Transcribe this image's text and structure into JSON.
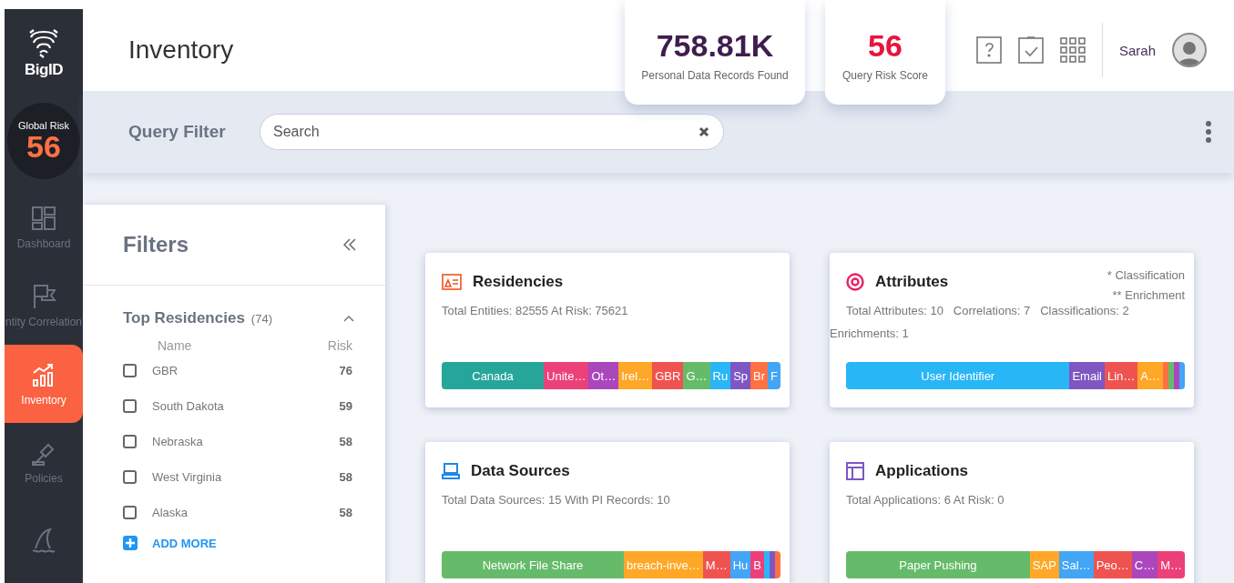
{
  "brand": "BigID",
  "global_risk": {
    "label": "Global Risk",
    "value": "56"
  },
  "nav": [
    {
      "label": "Dashboard",
      "selected": false
    },
    {
      "label": "ntity Correlation",
      "selected": false
    },
    {
      "label": "Inventory",
      "selected": true
    },
    {
      "label": "Policies",
      "selected": false
    },
    {
      "selected": false
    }
  ],
  "header": {
    "title": "Inventory",
    "user": "Sarah"
  },
  "stats": [
    {
      "value": "758.81K",
      "label": "Personal Data Records Found",
      "kind": "records"
    },
    {
      "value": "56",
      "label": "Query Risk Score",
      "kind": "risk"
    }
  ],
  "query_filter": {
    "label": "Query Filter",
    "placeholder": "Search"
  },
  "filters": {
    "title": "Filters",
    "section": {
      "title": "Top Residencies",
      "count": "(74)",
      "expanded": true,
      "columns": [
        "Name",
        "Risk"
      ],
      "rows": [
        {
          "name": "GBR",
          "risk": "76",
          "checked": false
        },
        {
          "name": "South Dakota",
          "risk": "59",
          "checked": false
        },
        {
          "name": "Nebraska",
          "risk": "58",
          "checked": false
        },
        {
          "name": "West Virginia",
          "risk": "58",
          "checked": false
        },
        {
          "name": "Alaska",
          "risk": "58",
          "checked": false
        }
      ],
      "add_more": "ADD MORE"
    }
  },
  "cards": [
    {
      "title": "Residencies",
      "lines": [
        "Total Entities: 82555 At Risk: 75621"
      ],
      "segments": [
        {
          "label": "Canada",
          "color": "#26a69a"
        },
        {
          "label": "Unite…",
          "color": "#ec407a"
        },
        {
          "label": "Ot…",
          "color": "#ab47bc"
        },
        {
          "label": "Irel…",
          "color": "#ffa726"
        },
        {
          "label": "GBR",
          "color": "#ef5350"
        },
        {
          "label": "G…",
          "color": "#66bb6a"
        },
        {
          "label": "Ru",
          "color": "#29b6f6"
        },
        {
          "label": "Sp",
          "color": "#7e57c2"
        },
        {
          "label": "Br",
          "color": "#ff7043"
        },
        {
          "label": "F",
          "color": "#42a5f5"
        }
      ]
    },
    {
      "title": "Attributes",
      "lines": [
        "Total Attributes: 10   Correlations: 7   Classifications: 2",
        "Enrichments: 1"
      ],
      "notes": [
        "* Classification",
        "** Enrichment"
      ],
      "segments": [
        {
          "label": "User Identifier",
          "color": "#29b6f6"
        },
        {
          "label": "Email",
          "color": "#7e57c2"
        },
        {
          "label": "Lin…",
          "color": "#ef5350"
        },
        {
          "label": "A…",
          "color": "#ffa726"
        },
        {
          "color": "#ff7043"
        },
        {
          "color": "#66bb6a"
        },
        {
          "color": "#ab47bc"
        },
        {
          "color": "#42a5f5"
        }
      ]
    },
    {
      "title": "Data Sources",
      "lines": [
        "Total Data Sources: 15 With PI Records: 10"
      ],
      "segments": [
        {
          "label": "Network File Share",
          "color": "#66bb6a"
        },
        {
          "label": "breach-inve…",
          "color": "#ffa726"
        },
        {
          "label": "M…",
          "color": "#ef5350"
        },
        {
          "label": "Hu",
          "color": "#42a5f5"
        },
        {
          "label": "B",
          "color": "#ec407a"
        },
        {
          "color": "#29b6f6"
        },
        {
          "color": "#7e57c2"
        },
        {
          "color": "#ff7043"
        }
      ]
    },
    {
      "title": "Applications",
      "lines": [
        "Total Applications: 6 At Risk: 0"
      ],
      "segments": [
        {
          "label": "Paper Pushing",
          "color": "#66bb6a"
        },
        {
          "label": "SAP",
          "color": "#ffa726"
        },
        {
          "label": "Sal…",
          "color": "#42a5f5"
        },
        {
          "label": "Peo…",
          "color": "#ef5350"
        },
        {
          "label": "C…",
          "color": "#ab47bc"
        },
        {
          "label": "M…",
          "color": "#ec407a"
        }
      ]
    }
  ]
}
